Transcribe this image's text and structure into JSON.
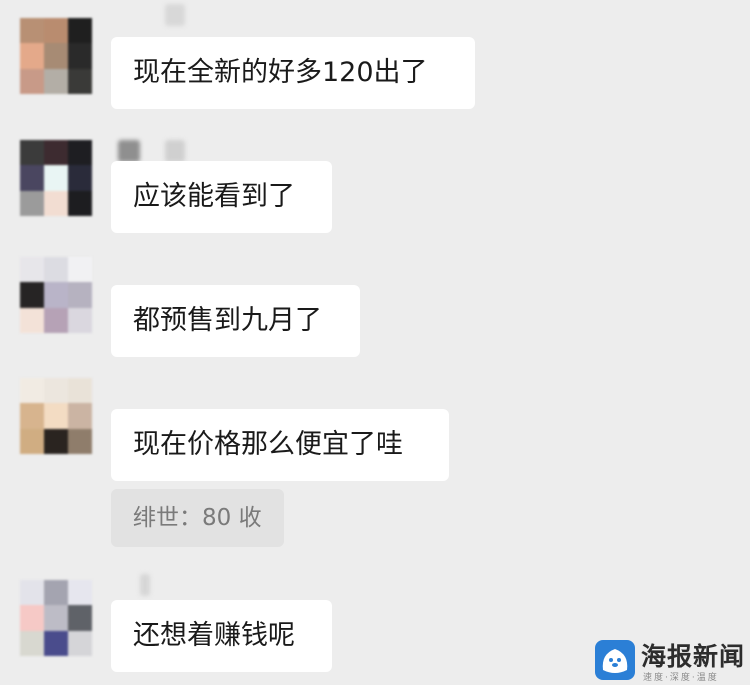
{
  "messages": [
    {
      "text": "现在全新的好多120出了"
    },
    {
      "text": "应该能看到了"
    },
    {
      "text": "都预售到九月了"
    },
    {
      "text": "现在价格那么便宜了哇",
      "quote": "绯世：80 收"
    },
    {
      "text": "还想着赚钱呢"
    }
  ],
  "watermark": {
    "title": "海报新闻",
    "subtitle": "速度·深度·温度",
    "icon": "seal-mascot-icon",
    "brand_color": "#2b7fd6"
  },
  "colors": {
    "background": "#ededed",
    "bubble": "#ffffff",
    "quote_bubble": "#e2e2e2"
  }
}
